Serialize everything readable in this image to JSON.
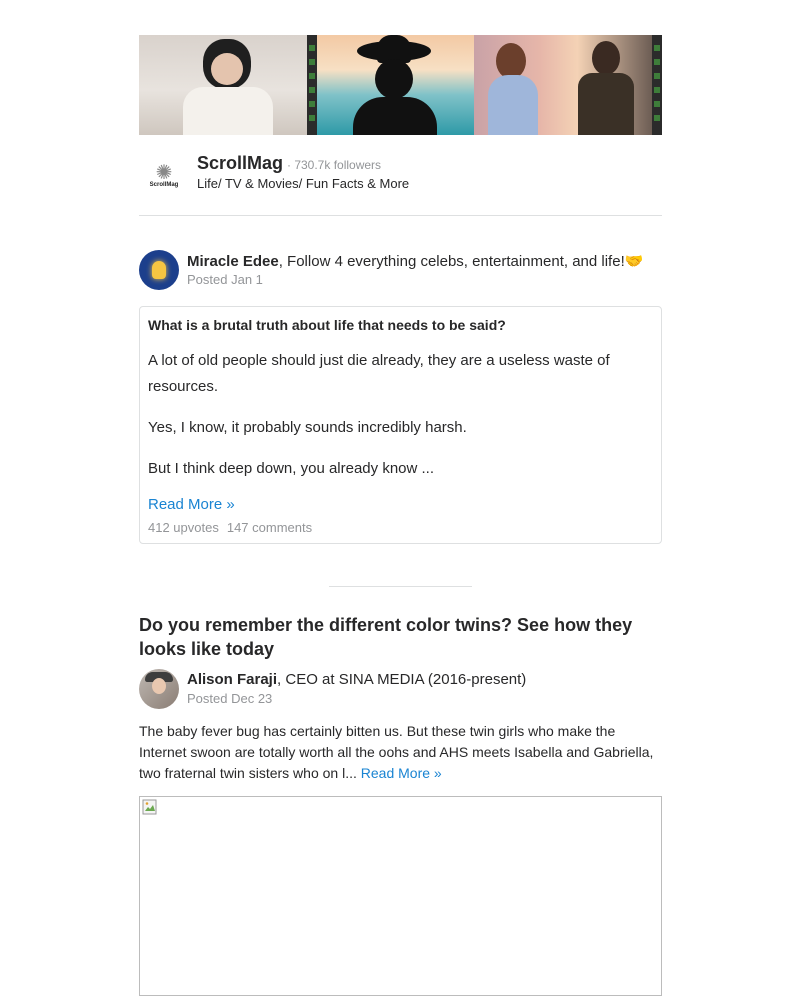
{
  "space": {
    "logo_text": "ScrollMag",
    "name": "ScrollMag",
    "followers": "· 730.7k followers",
    "description": "Life/ TV & Movies/ Fun Facts & More"
  },
  "post1": {
    "author_name": "Miracle Edee",
    "author_bio": ", Follow 4 everything celebs, entertainment, and life!🤝",
    "posted": "Posted Jan 1",
    "question": "What is a brutal truth about life that needs to be said?",
    "paragraphs": [
      "A lot of old people should just die already, they are a useless waste of resources.",
      "Yes, I know, it probably sounds incredibly harsh.",
      "But I think deep down, you already know ..."
    ],
    "read_more": "Read More »",
    "upvotes": "412 upvotes",
    "comments": "147 comments"
  },
  "post2": {
    "title": "Do you remember the different color twins? See how they looks like today",
    "author_name": "Alison Faraji",
    "author_bio": ", CEO at SINA MEDIA (2016-present)",
    "posted": "Posted Dec 23",
    "body": "The baby fever bug has certainly bitten us. But these twin girls who make the Internet swoon are totally worth all the oohs and AHS meets Isabella and Gabriella, two fraternal twin sisters who on l... ",
    "read_more": "Read More »"
  },
  "icons": [
    "scrollmag-logo-icon",
    "lightbulb-avatar-icon",
    "person-avatar-icon",
    "broken-image-icon"
  ]
}
